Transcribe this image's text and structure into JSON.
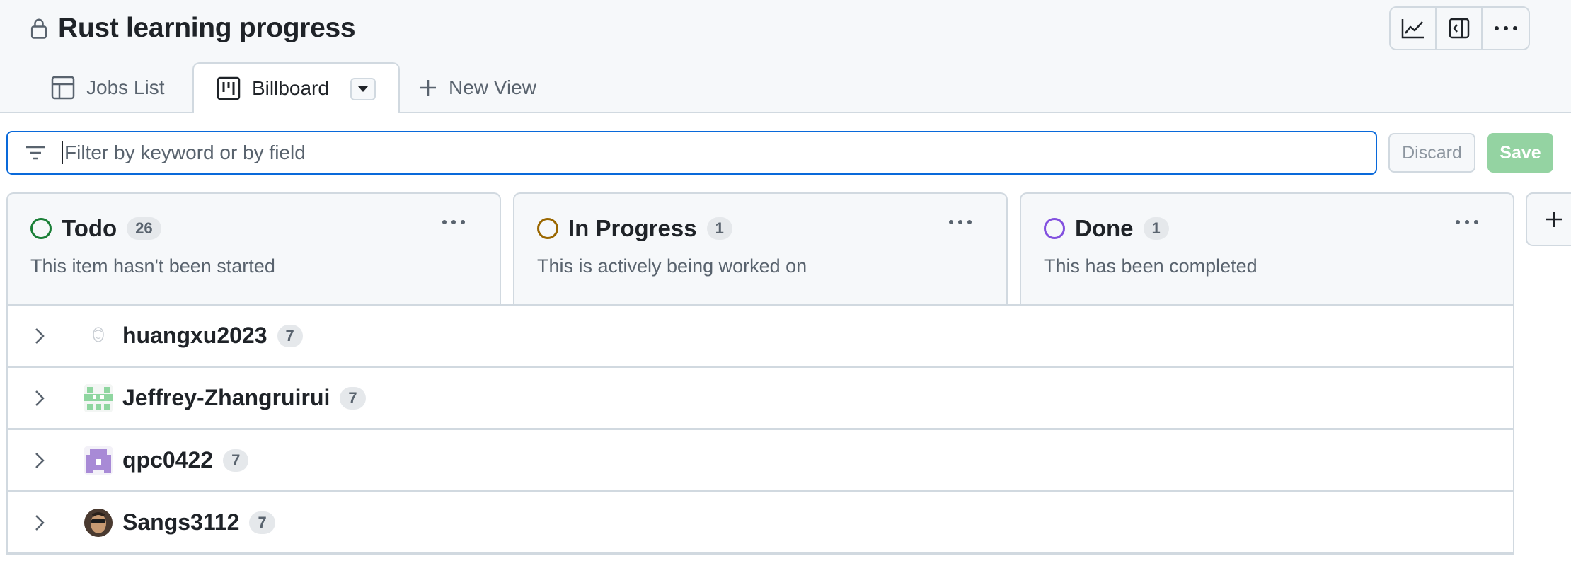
{
  "page": {
    "title": "Rust learning progress"
  },
  "toolbar": {
    "icons": [
      "chart-icon",
      "sidebar-panel-icon",
      "more-icon"
    ]
  },
  "tabs": [
    {
      "label": "Jobs List",
      "icon": "table-icon"
    },
    {
      "label": "Billboard",
      "icon": "board-icon",
      "active": true
    },
    {
      "label": "New View",
      "icon": "plus-icon"
    }
  ],
  "filter": {
    "placeholder": "Filter by keyword or by field",
    "value": ""
  },
  "actions": {
    "discard": "Discard",
    "save": "Save"
  },
  "columns": [
    {
      "name": "Todo",
      "count": "26",
      "description": "This item hasn't been started",
      "color": "#1a7f37"
    },
    {
      "name": "In Progress",
      "count": "1",
      "description": "This is actively being worked on",
      "color": "#9a6700"
    },
    {
      "name": "Done",
      "count": "1",
      "description": "This has been completed",
      "color": "#8250df"
    }
  ],
  "groups": [
    {
      "name": "huangxu2023",
      "count": "7"
    },
    {
      "name": "Jeffrey-Zhangruirui",
      "count": "7"
    },
    {
      "name": "qpc0422",
      "count": "7"
    },
    {
      "name": "Sangs3112",
      "count": "7"
    }
  ]
}
